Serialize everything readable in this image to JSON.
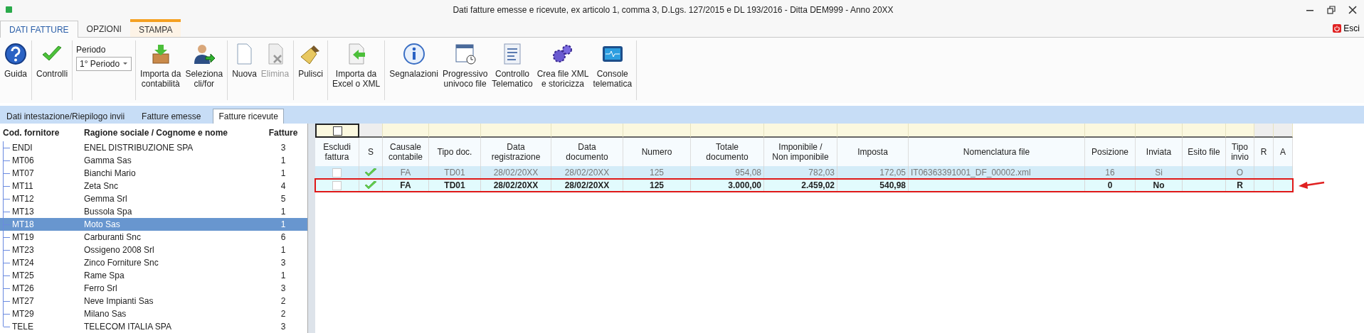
{
  "window": {
    "title": "Dati fatture emesse e ricevute, ex articolo 1, comma 3, D.Lgs. 127/2015 e DL 193/2016 - Ditta DEM999 - Anno 20XX",
    "exit": "Esci"
  },
  "ribbon_tabs": [
    {
      "label": "DATI FATTURE",
      "selected": true,
      "contextual": false
    },
    {
      "label": "OPZIONI",
      "selected": false,
      "contextual": false
    },
    {
      "label": "STAMPA",
      "selected": false,
      "contextual": true
    }
  ],
  "ribbon_groups": [
    {
      "kind": "buttons",
      "buttons": [
        {
          "label": "Guida",
          "disabled": false
        }
      ]
    },
    {
      "kind": "buttons",
      "buttons": [
        {
          "label": "Controlli",
          "disabled": false
        }
      ]
    },
    {
      "kind": "period",
      "label": "Periodo",
      "value": "1° Periodo"
    },
    {
      "kind": "buttons",
      "buttons": [
        {
          "label": "Importa da\ncontabilità",
          "disabled": false
        },
        {
          "label": "Seleziona\ncli/for",
          "disabled": false
        }
      ]
    },
    {
      "kind": "buttons",
      "buttons": [
        {
          "label": "Nuova",
          "disabled": false
        },
        {
          "label": "Elimina",
          "disabled": true
        }
      ]
    },
    {
      "kind": "buttons",
      "buttons": [
        {
          "label": "Pulisci",
          "disabled": false
        }
      ]
    },
    {
      "kind": "buttons",
      "buttons": [
        {
          "label": "Importa da\nExcel o XML",
          "disabled": false
        }
      ]
    },
    {
      "kind": "buttons",
      "buttons": [
        {
          "label": "Segnalazioni",
          "disabled": false
        },
        {
          "label": "Progressivo\nunivoco file",
          "disabled": false
        },
        {
          "label": "Controllo\nTelematico",
          "disabled": false
        },
        {
          "label": "Crea file XML\ne storicizza",
          "disabled": false
        },
        {
          "label": "Console\ntelematica",
          "disabled": false
        }
      ]
    }
  ],
  "page_tabs": [
    {
      "label": "Dati intestazione/Riepilogo invii",
      "selected": false
    },
    {
      "label": "Fatture emesse",
      "selected": false
    },
    {
      "label": "Fatture ricevute",
      "selected": true
    }
  ],
  "suppliers": {
    "columns": [
      "Cod. fornitore",
      "Ragione sociale / Cognome e nome",
      "Fatture"
    ],
    "rows": [
      {
        "code": "ENDI",
        "name": "ENEL DISTRIBUZIONE SPA",
        "count": "3",
        "selected": false
      },
      {
        "code": "MT06",
        "name": "Gamma Sas",
        "count": "1",
        "selected": false
      },
      {
        "code": "MT07",
        "name": "Bianchi Mario",
        "count": "1",
        "selected": false
      },
      {
        "code": "MT11",
        "name": "Zeta Snc",
        "count": "4",
        "selected": false
      },
      {
        "code": "MT12",
        "name": "Gemma Srl",
        "count": "5",
        "selected": false
      },
      {
        "code": "MT13",
        "name": "Bussola Spa",
        "count": "1",
        "selected": false
      },
      {
        "code": "MT18",
        "name": "Moto Sas",
        "count": "1",
        "selected": true
      },
      {
        "code": "MT19",
        "name": "Carburanti Snc",
        "count": "6",
        "selected": false
      },
      {
        "code": "MT23",
        "name": "Ossigeno 2008 Srl",
        "count": "1",
        "selected": false
      },
      {
        "code": "MT24",
        "name": "Zinco Forniture Snc",
        "count": "3",
        "selected": false
      },
      {
        "code": "MT25",
        "name": "Rame Spa",
        "count": "1",
        "selected": false
      },
      {
        "code": "MT26",
        "name": "Ferro Srl",
        "count": "3",
        "selected": false
      },
      {
        "code": "MT27",
        "name": "Neve Impianti Sas",
        "count": "2",
        "selected": false
      },
      {
        "code": "MT29",
        "name": "Milano Sas",
        "count": "2",
        "selected": false
      },
      {
        "code": "TELE",
        "name": "TELECOM ITALIA SPA",
        "count": "3",
        "selected": false
      }
    ]
  },
  "invoices": {
    "select_all_checked": false,
    "columns": [
      "Escludi\nfattura",
      "S",
      "Causale\ncontabile",
      "Tipo doc.",
      "Data\nregistrazione",
      "Data\ndocumento",
      "Numero",
      "Totale\ndocumento",
      "Imponibile /\nNon imponibile",
      "Imposta",
      "Nomenclatura file",
      "Posizione",
      "Inviata",
      "Esito file",
      "Tipo\ninvio",
      "R",
      "A"
    ],
    "rows": [
      {
        "excluded": false,
        "checked_ok": true,
        "sent": true,
        "highlighted": false,
        "cells": [
          "",
          "",
          "FA",
          "TD01",
          "28/02/20XX",
          "28/02/20XX",
          "125",
          "954,08",
          "782,03",
          "172,05",
          "IT06363391001_DF_00002.xml",
          "16",
          "Si",
          "",
          "O",
          "",
          ""
        ]
      },
      {
        "excluded": false,
        "checked_ok": true,
        "sent": false,
        "highlighted": true,
        "cells": [
          "",
          "",
          "FA",
          "TD01",
          "28/02/20XX",
          "28/02/20XX",
          "125",
          "3.000,00",
          "2.459,02",
          "540,98",
          "",
          "0",
          "No",
          "",
          "R",
          "",
          ""
        ]
      }
    ]
  }
}
